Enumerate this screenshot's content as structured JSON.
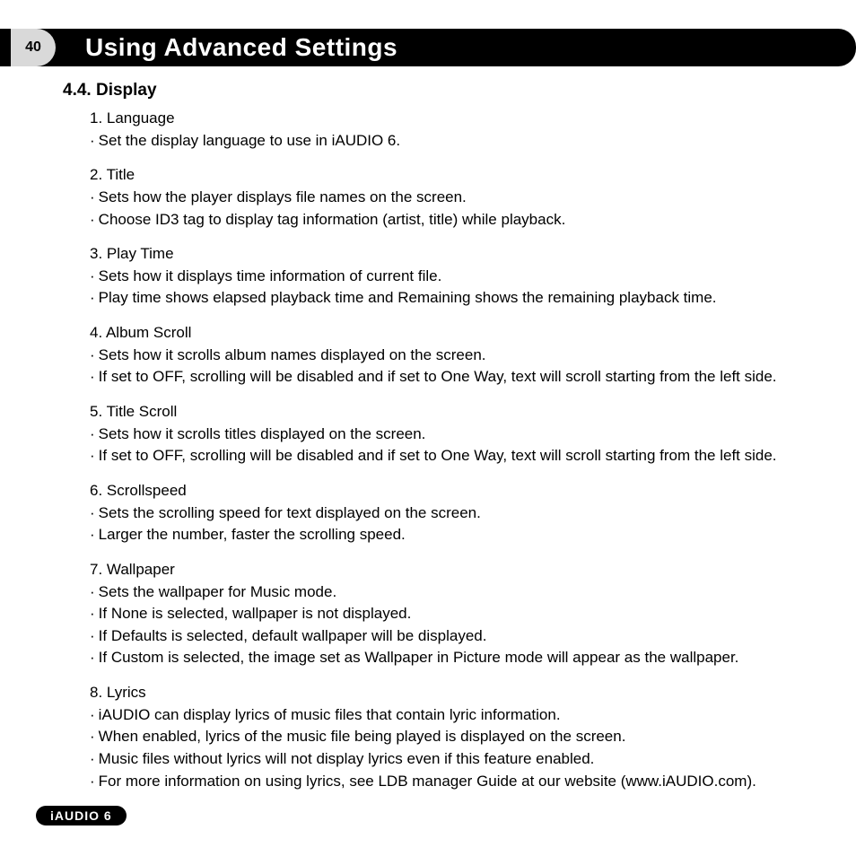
{
  "page_number": "40",
  "header_title": "Using Advanced Settings",
  "section_heading": "4.4. Display",
  "items": [
    {
      "title": "1. Language",
      "bullets": [
        "Set the display language to use in iAUDIO 6."
      ]
    },
    {
      "title": "2. Title",
      "bullets": [
        "Sets how the player displays file names on the screen.",
        "Choose ID3 tag to display tag information (artist, title) while playback."
      ]
    },
    {
      "title": "3. Play Time",
      "bullets": [
        "Sets how it displays time information of current file.",
        "Play time shows elapsed playback time and Remaining shows the remaining playback time."
      ]
    },
    {
      "title": "4. Album Scroll",
      "bullets": [
        "Sets how it scrolls album names displayed on the screen.",
        "If set to OFF, scrolling will be disabled and if set to One Way, text will scroll starting from the left side."
      ]
    },
    {
      "title": "5. Title Scroll",
      "bullets": [
        "Sets how it scrolls titles displayed on the screen.",
        "If set to OFF, scrolling will be disabled and if set to One Way, text will scroll starting from the left side."
      ]
    },
    {
      "title": "6. Scrollspeed",
      "bullets": [
        "Sets the scrolling speed for text displayed on the screen.",
        "Larger the number, faster the scrolling speed."
      ]
    },
    {
      "title": "7. Wallpaper",
      "bullets": [
        "Sets the wallpaper for Music mode.",
        "If None is selected, wallpaper is not displayed.",
        "If Defaults is selected, default wallpaper will be displayed.",
        "If Custom is selected, the image set as Wallpaper in Picture mode will appear as the wallpaper."
      ]
    },
    {
      "title": "8. Lyrics",
      "bullets": [
        "iAUDIO can display lyrics of music files that contain lyric information.",
        "When enabled, lyrics of the music file being played is displayed on the screen.",
        "Music files without lyrics will not display lyrics even if this feature enabled.",
        "For more information on using lyrics, see LDB manager Guide at our website (www.iAUDIO.com)."
      ]
    }
  ],
  "footer_label": "iAUDIO 6"
}
